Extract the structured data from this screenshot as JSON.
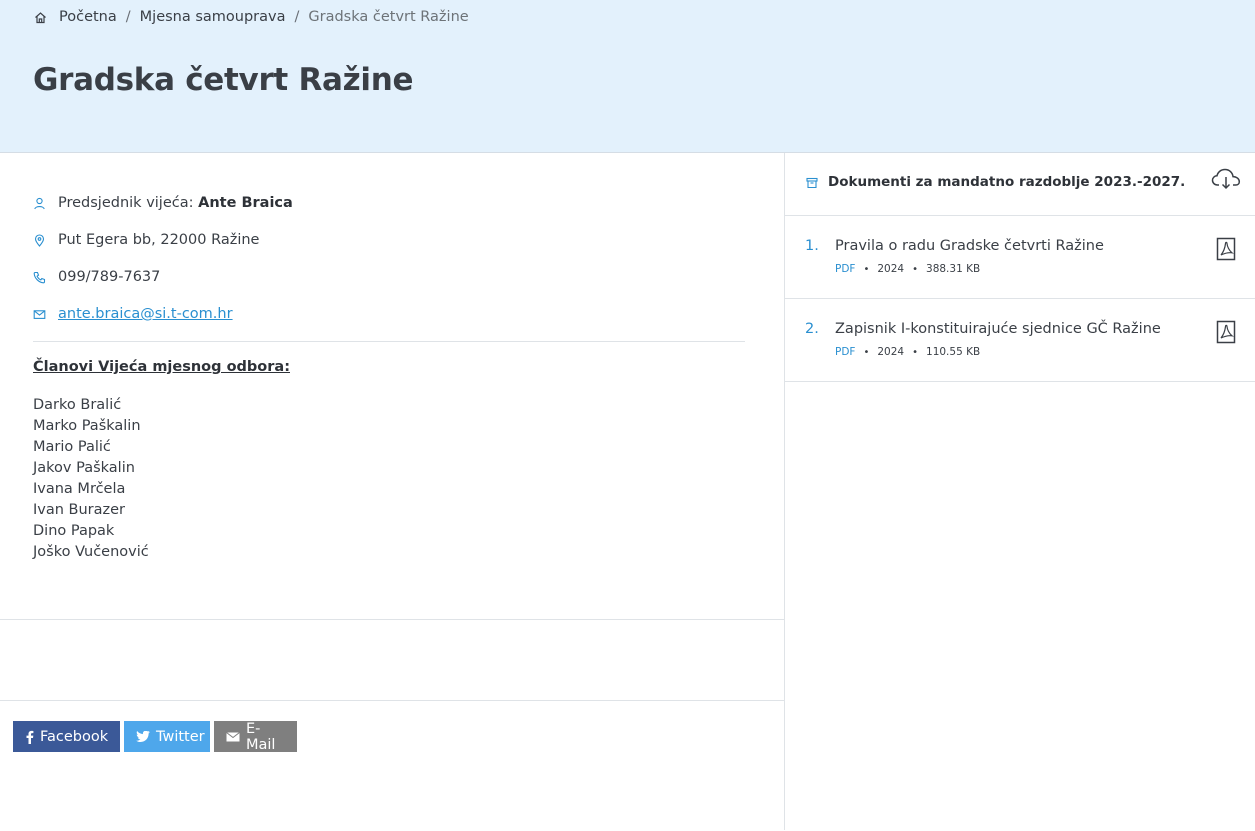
{
  "breadcrumb": {
    "home_icon": "home-icon",
    "items": [
      "Početna",
      "Mjesna samouprava"
    ],
    "separator": "/",
    "current": "Gradska četvrt Ražine"
  },
  "page": {
    "title": "Gradska četvrt Ražine"
  },
  "info": {
    "president_label": "Predsjednik vijeća:",
    "president_name": "Ante Braica",
    "address": "Put Egera bb, 22000 Ražine",
    "phone": "099/789-7637",
    "email": "ante.braica@si.t-com.hr"
  },
  "members": {
    "title": "Članovi Vijeća mjesnog odbora:",
    "names": [
      "Darko Bralić",
      "Marko Paškalin",
      "Mario Palić",
      "Jakov Paškalin",
      "Ivana Mrčela",
      "Ivan Burazer",
      "Dino Papak",
      "Joško Vučenović"
    ]
  },
  "share": {
    "facebook": "Facebook",
    "twitter": "Twitter",
    "email": "E-Mail"
  },
  "documents": {
    "title": "Dokumenti za mandatno razdoblje 2023.-2027.",
    "items": [
      {
        "num": "1.",
        "title": "Pravila o radu Gradske četvrti Ražine",
        "type": "PDF",
        "year": "2024",
        "size": "388.31 KB"
      },
      {
        "num": "2.",
        "title": "Zapisnik I-konstituirajuće sjednice GČ Ražine",
        "type": "PDF",
        "year": "2024",
        "size": "110.55 KB"
      }
    ]
  },
  "colors": {
    "hero_bg": "#e3f1fc",
    "accent": "#2a8fd0",
    "facebook": "#3b5998",
    "twitter": "#4ea7eb",
    "email_btn": "#7f7f7f"
  }
}
